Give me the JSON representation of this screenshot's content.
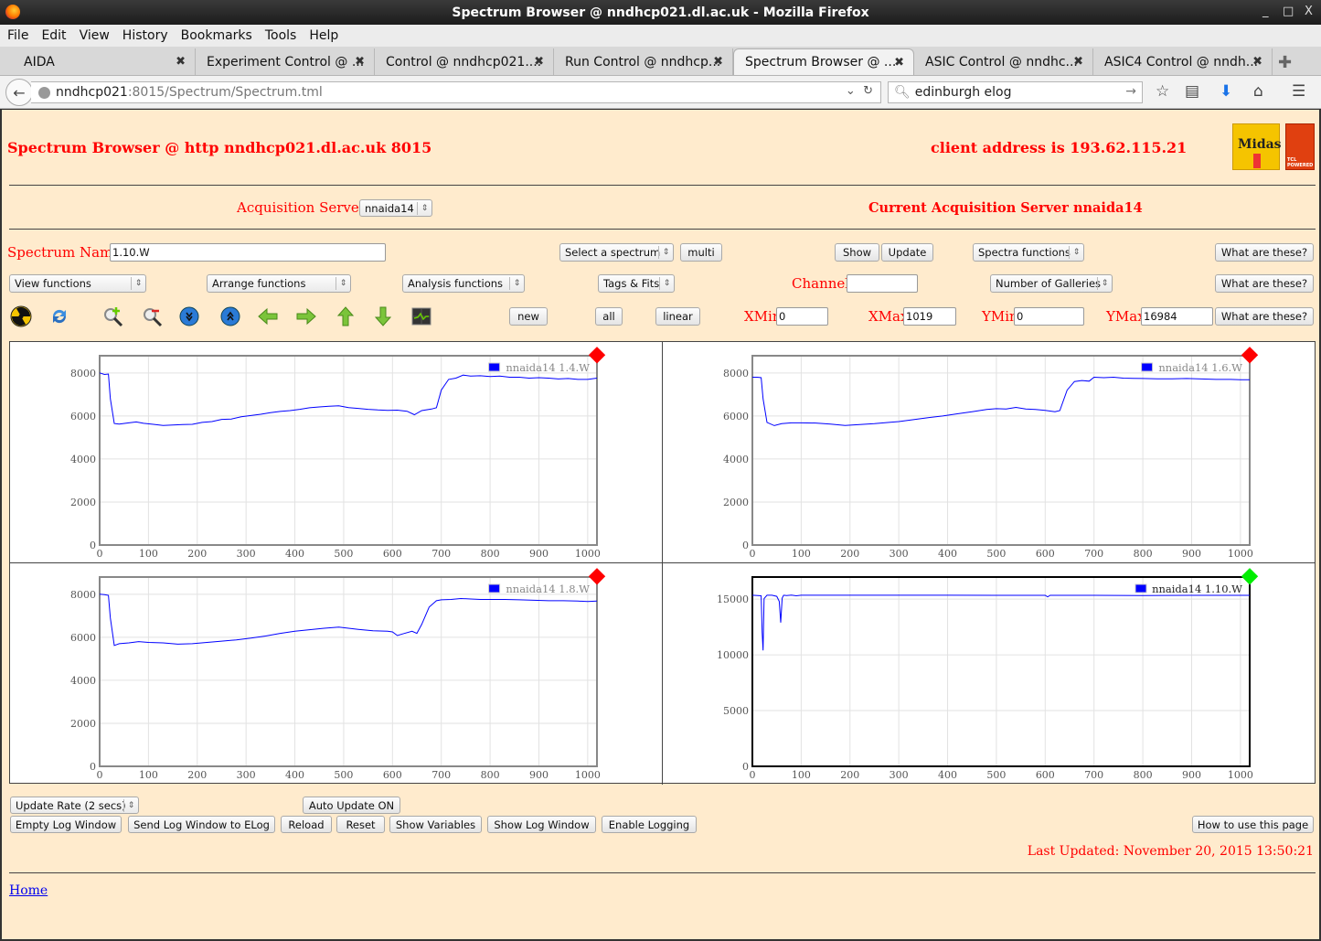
{
  "window": {
    "title": "Spectrum Browser @ nndhcp021.dl.ac.uk - Mozilla Firefox",
    "controls": [
      "_",
      "□",
      "X"
    ]
  },
  "menu": [
    "File",
    "Edit",
    "View",
    "History",
    "Bookmarks",
    "Tools",
    "Help"
  ],
  "tabs": [
    {
      "label": "AIDA",
      "active": false
    },
    {
      "label": "Experiment Control @ ...",
      "active": false
    },
    {
      "label": "Control @ nndhcp021....",
      "active": false
    },
    {
      "label": "Run Control @ nndhcp...",
      "active": false
    },
    {
      "label": "Spectrum Browser @ ...",
      "active": true
    },
    {
      "label": "ASIC Control @ nndhc...",
      "active": false
    },
    {
      "label": "ASIC4 Control @ nndh...",
      "active": false
    }
  ],
  "nav": {
    "url_host": "nndhcp021",
    "url_path": ":8015/Spectrum/Spectrum.tml",
    "search_value": "edinburgh elog"
  },
  "page": {
    "heading": "Spectrum Browser @ http nndhcp021.dl.ac.uk 8015",
    "client_address": "client address is 193.62.115.21",
    "logos": {
      "midas": "Midas",
      "tcl": "TCL POWERED"
    },
    "acq_label": "Acquisition Servers",
    "acq_value": "nnaida14",
    "current_server": "Current Acquisition Server nnaida14",
    "spectrum_name_label": "Spectrum Name:",
    "spectrum_name_value": "1.10.W",
    "select_spectrum": "Select a spectrum",
    "multi": "multi",
    "show": "Show",
    "update": "Update",
    "spectra_functions": "Spectra functions",
    "what_are_these": "What are these?",
    "view_functions": "View functions",
    "arrange_functions": "Arrange functions",
    "analysis_functions": "Analysis functions",
    "tags_fits": "Tags & Fits",
    "channel_label": "Channel:",
    "channel_value": "",
    "galleries": "Number of Galleries",
    "new": "new",
    "all": "all",
    "linear": "linear",
    "xmin_label": "XMin",
    "xmin_value": "0",
    "xmax_label": "XMax",
    "xmax_value": "1019",
    "ymin_label": "YMin",
    "ymin_value": "0",
    "ymax_label": "YMax",
    "ymax_value": "16984",
    "toolbar_icons": [
      "radiation-icon",
      "refresh-icon",
      "zoom-in-icon",
      "zoom-out-icon",
      "scroll-down-icon",
      "scroll-up-icon",
      "arrow-left-icon",
      "arrow-right-icon",
      "arrow-up-icon",
      "arrow-down-icon",
      "display-icon"
    ],
    "update_rate": "Update Rate (2 secs)",
    "auto_update": "Auto Update ON",
    "bottom_buttons": [
      "Empty Log Window",
      "Send Log Window to ELog",
      "Reload",
      "Reset",
      "Show Variables",
      "Show Log Window",
      "Enable Logging"
    ],
    "how_to": "How to use this page",
    "last_updated": "Last Updated: November 20, 2015 13:50:21",
    "home": "Home"
  },
  "colors": {
    "page_bg": "#ffebcd",
    "accent_red": "#ff0000",
    "series": "#0000ff",
    "status_bad": "#ff0000",
    "status_ok": "#00ee00"
  },
  "chart_data": [
    {
      "type": "line",
      "title": "",
      "legend": "nnaida14 1.4.W",
      "legend_position": "top-right",
      "status": "red",
      "selected": false,
      "xlim": [
        0,
        1019
      ],
      "ylim": [
        0,
        8800
      ],
      "xticks": [
        0,
        100,
        200,
        300,
        400,
        500,
        600,
        700,
        800,
        900,
        1000
      ],
      "yticks": [
        0,
        2000,
        4000,
        6000,
        8000
      ],
      "x": [
        0,
        10,
        18,
        22,
        30,
        40,
        60,
        75,
        90,
        110,
        130,
        150,
        170,
        190,
        210,
        230,
        250,
        270,
        290,
        310,
        330,
        350,
        370,
        390,
        410,
        430,
        450,
        470,
        490,
        510,
        530,
        550,
        570,
        590,
        610,
        630,
        645,
        660,
        680,
        690,
        700,
        715,
        730,
        745,
        760,
        780,
        800,
        820,
        840,
        860,
        880,
        900,
        920,
        940,
        960,
        980,
        1000,
        1019
      ],
      "y": [
        8000,
        7930,
        7950,
        6800,
        5650,
        5620,
        5680,
        5720,
        5660,
        5610,
        5560,
        5580,
        5600,
        5610,
        5700,
        5740,
        5840,
        5860,
        5960,
        6020,
        6080,
        6150,
        6210,
        6250,
        6310,
        6380,
        6420,
        6450,
        6470,
        6390,
        6350,
        6310,
        6280,
        6260,
        6270,
        6220,
        6060,
        6250,
        6320,
        6380,
        7200,
        7700,
        7760,
        7900,
        7850,
        7870,
        7830,
        7850,
        7800,
        7800,
        7760,
        7780,
        7760,
        7720,
        7740,
        7700,
        7700,
        7760
      ]
    },
    {
      "type": "line",
      "title": "",
      "legend": "nnaida14 1.6.W",
      "legend_position": "top-right",
      "status": "red",
      "selected": false,
      "xlim": [
        0,
        1019
      ],
      "ylim": [
        0,
        8800
      ],
      "xticks": [
        0,
        100,
        200,
        300,
        400,
        500,
        600,
        700,
        800,
        900,
        1000
      ],
      "yticks": [
        0,
        2000,
        4000,
        6000,
        8000
      ],
      "x": [
        0,
        10,
        18,
        22,
        30,
        45,
        60,
        80,
        100,
        130,
        160,
        190,
        220,
        250,
        280,
        300,
        330,
        360,
        390,
        420,
        450,
        480,
        500,
        520,
        540,
        560,
        580,
        600,
        620,
        630,
        645,
        660,
        675,
        690,
        700,
        720,
        740,
        760,
        780,
        800,
        830,
        860,
        890,
        920,
        950,
        980,
        1000,
        1019
      ],
      "y": [
        7800,
        7800,
        7780,
        6800,
        5700,
        5550,
        5640,
        5680,
        5680,
        5670,
        5620,
        5560,
        5600,
        5640,
        5700,
        5740,
        5830,
        5920,
        6000,
        6100,
        6200,
        6300,
        6340,
        6320,
        6400,
        6320,
        6300,
        6260,
        6200,
        6250,
        7200,
        7600,
        7650,
        7620,
        7800,
        7780,
        7800,
        7760,
        7750,
        7740,
        7730,
        7730,
        7740,
        7720,
        7700,
        7700,
        7680,
        7680
      ]
    },
    {
      "type": "line",
      "title": "",
      "legend": "nnaida14 1.8.W",
      "legend_position": "top-right",
      "status": "red",
      "selected": false,
      "xlim": [
        0,
        1019
      ],
      "ylim": [
        0,
        8800
      ],
      "xticks": [
        0,
        100,
        200,
        300,
        400,
        500,
        600,
        700,
        800,
        900,
        1000
      ],
      "yticks": [
        0,
        2000,
        4000,
        6000,
        8000
      ],
      "x": [
        0,
        10,
        18,
        22,
        30,
        40,
        60,
        80,
        100,
        130,
        160,
        190,
        220,
        250,
        280,
        310,
        340,
        370,
        400,
        430,
        460,
        490,
        510,
        530,
        560,
        590,
        600,
        610,
        620,
        640,
        650,
        660,
        675,
        690,
        700,
        720,
        740,
        760,
        780,
        800,
        830,
        860,
        890,
        920,
        950,
        980,
        1000,
        1019
      ],
      "y": [
        8000,
        7980,
        7950,
        6900,
        5620,
        5700,
        5740,
        5800,
        5760,
        5740,
        5680,
        5700,
        5760,
        5820,
        5880,
        5960,
        6060,
        6180,
        6280,
        6350,
        6420,
        6470,
        6420,
        6370,
        6300,
        6280,
        6250,
        6080,
        6150,
        6280,
        6180,
        6600,
        7400,
        7700,
        7740,
        7760,
        7800,
        7780,
        7760,
        7760,
        7760,
        7740,
        7720,
        7700,
        7700,
        7680,
        7660,
        7680
      ]
    },
    {
      "type": "line",
      "title": "",
      "legend": "nnaida14 1.10.W",
      "legend_position": "top-right",
      "status": "green",
      "selected": true,
      "xlim": [
        0,
        1019
      ],
      "ylim": [
        0,
        16984
      ],
      "xticks": [
        0,
        100,
        200,
        300,
        400,
        500,
        600,
        700,
        800,
        900,
        1000
      ],
      "yticks": [
        0,
        5000,
        10000,
        15000
      ],
      "x": [
        0,
        18,
        20,
        22,
        24,
        30,
        40,
        50,
        55,
        58,
        61,
        64,
        70,
        80,
        90,
        100,
        200,
        300,
        400,
        500,
        600,
        605,
        610,
        700,
        800,
        900,
        1000,
        1019
      ],
      "y": [
        15350,
        15300,
        12000,
        10400,
        15050,
        15350,
        15350,
        15250,
        14800,
        12900,
        15100,
        15350,
        15320,
        15360,
        15300,
        15350,
        15350,
        15350,
        15350,
        15340,
        15340,
        15200,
        15340,
        15340,
        15330,
        15340,
        15340,
        15340
      ]
    }
  ]
}
